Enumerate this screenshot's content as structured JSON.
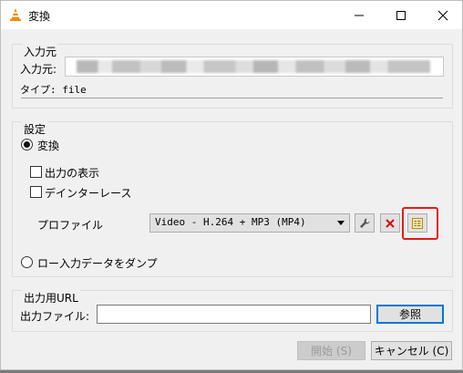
{
  "window": {
    "title": "変換",
    "icon": "vlc-cone-icon",
    "controls": [
      "minimize-icon",
      "maximize-icon",
      "close-icon"
    ]
  },
  "source": {
    "group_title": "入力元",
    "field_label": "入力元:",
    "field_value": "",
    "type_label": "タイプ: file"
  },
  "settings": {
    "group_title": "設定",
    "convert_label": "変換",
    "show_output_label": "出力の表示",
    "deinterlace_label": "デインターレース",
    "profile_label": "プロファイル",
    "profile_value": "Video - H.264 + MP3 (MP4)",
    "dump_label": "ロー入力データをダンプ"
  },
  "destination": {
    "group_title": "出力用URL",
    "file_label": "出力ファイル:",
    "file_value": "",
    "browse_label": "参照"
  },
  "footer": {
    "start_label": "開始 (S)",
    "cancel_label": "キャンセル (C)"
  },
  "colors": {
    "highlight": "#e51a1a",
    "vlc_orange": "#f48b00",
    "delete_red": "#d01010"
  }
}
